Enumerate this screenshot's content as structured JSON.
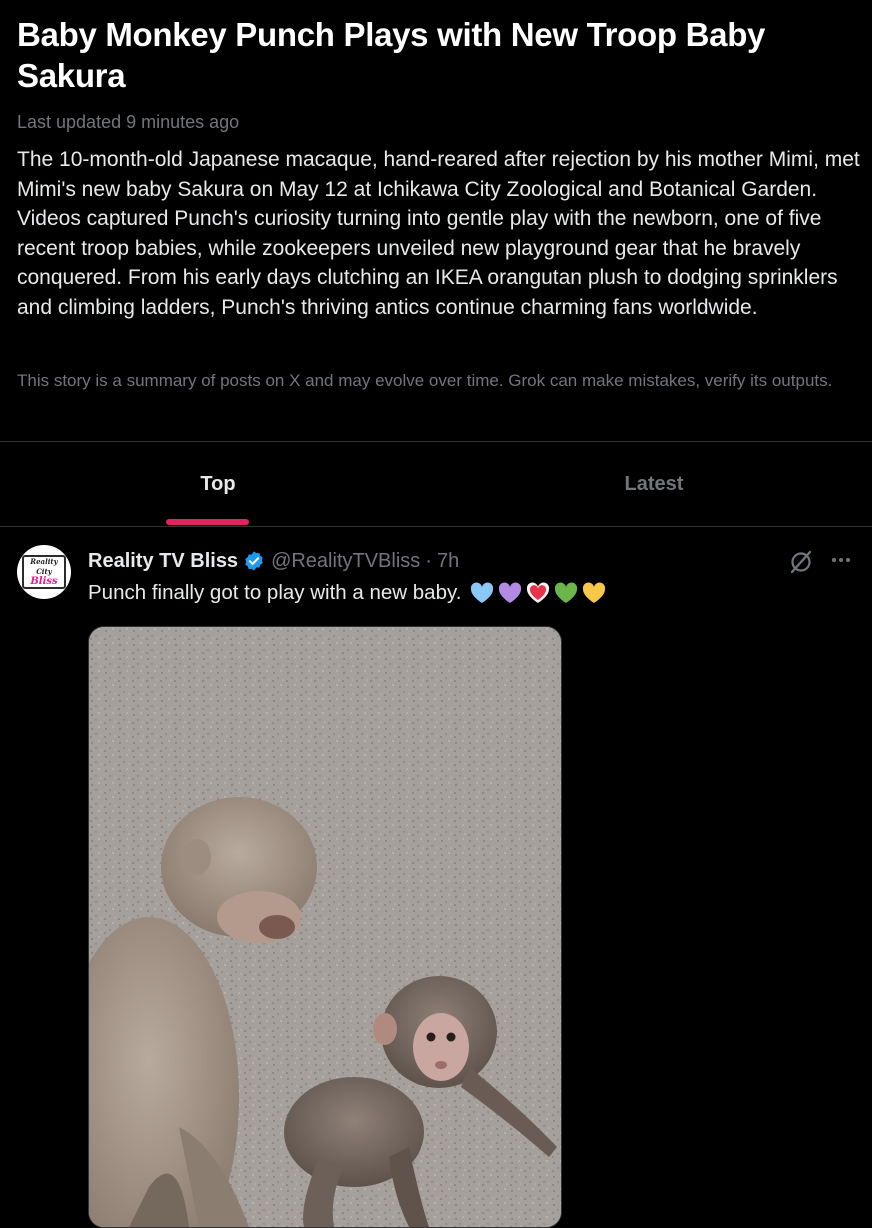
{
  "story": {
    "title": "Baby Monkey Punch Plays with New Troop Baby Sakura",
    "updated": "Last updated 9 minutes ago",
    "summary": "The 10-month-old Japanese macaque, hand-reared after rejection by his mother Mimi, met Mimi's new baby Sakura on May 12 at Ichikawa City Zoological and Botanical Garden. Videos captured Punch's curiosity turning into gentle play with the newborn, one of five recent troop babies, while zookeepers unveiled new playground gear that he bravely conquered. From his early days clutching an IKEA orangutan plush to dodging sprinklers and climbing ladders, Punch's thriving antics continue charming fans worldwide.",
    "disclaimer": "This story is a summary of posts on X and may evolve over time. Grok can make mistakes, verify its outputs."
  },
  "tabs": [
    {
      "label": "Top",
      "active": true
    },
    {
      "label": "Latest",
      "active": false
    }
  ],
  "post": {
    "display_name": "Reality TV Bliss",
    "handle": "@RealityTVBliss",
    "separator": "·",
    "time": "7h",
    "text": "Punch finally got to play with a new baby.",
    "avatar_logo_line1": "Reality City",
    "avatar_logo_line2": "Bliss",
    "emojis": [
      "blue-heart",
      "purple-heart",
      "red-heart",
      "green-heart",
      "yellow-heart"
    ],
    "media_alt": "Two Japanese macaques on gravel ground, an older monkey beside a baby monkey"
  },
  "colors": {
    "background": "#000000",
    "text_primary": "#e7e9ea",
    "text_secondary": "#71767b",
    "tab_accent": "#e0245e",
    "verified": "#1d9bf0",
    "divider": "#2f3336"
  }
}
